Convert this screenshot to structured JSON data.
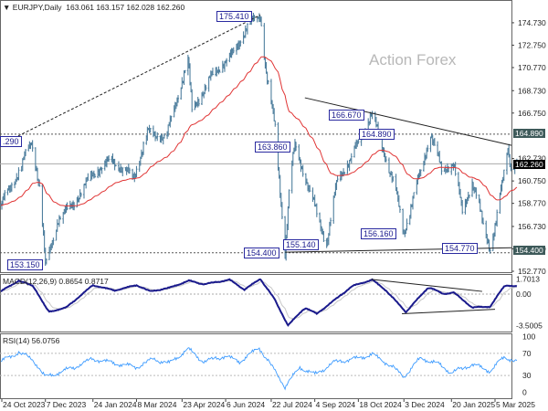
{
  "header": {
    "symbol_title": "EURJPY,Daily",
    "ohlc": "163.061 163.157 162.028 162.260"
  },
  "watermark": "Action Forex",
  "colors": {
    "bars": "#4f7f9e",
    "moving_average": "#e03434",
    "macd": "#1a1a8c",
    "macd_signal": "#c8c8c8",
    "rsi": "#3d9bff",
    "trendline": "#222222"
  },
  "chart_data": [
    {
      "type": "ohlc",
      "title": "EURJPY,Daily",
      "ylim": [
        152.77,
        175.9
      ],
      "yticks": [
        "174.730",
        "172.750",
        "170.770",
        "168.730",
        "166.750",
        "162.730",
        "160.750",
        "158.770",
        "156.730",
        "154.750",
        "152.770"
      ],
      "xticks": [
        {
          "label": "24 Oct 2023",
          "date": "2023-10-24"
        },
        {
          "label": "7 Dec 2023",
          "date": "2023-12-07"
        },
        {
          "label": "24 Jan 2024",
          "date": "2024-01-24"
        },
        {
          "label": "8 Mar 2024",
          "date": "2024-03-08"
        },
        {
          "label": "23 Apr 2024",
          "date": "2024-04-23"
        },
        {
          "label": "6 Jun 2024",
          "date": "2024-06-06"
        },
        {
          "label": "22 Jul 2024",
          "date": "2024-07-22"
        },
        {
          "label": "4 Sep 2024",
          "date": "2024-09-04"
        },
        {
          "label": "18 Oct 2024",
          "date": "2024-10-18"
        },
        {
          "label": "3 Dec 2024",
          "date": "2024-12-03"
        },
        {
          "label": "20 Jan 2025",
          "date": "2025-01-20"
        },
        {
          "label": "5 Mar 2025",
          "date": "2025-03-05"
        }
      ],
      "closes": [
        [
          "2023-10-23",
          158.6
        ],
        [
          "2023-11-09",
          161.4
        ],
        [
          "2023-11-23",
          164.2
        ],
        [
          "2023-12-02",
          159.8
        ],
        [
          "2023-12-07",
          153.15
        ],
        [
          "2023-12-20",
          157.4
        ],
        [
          "2024-01-03",
          158.6
        ],
        [
          "2024-01-24",
          161.4
        ],
        [
          "2024-02-12",
          162.6
        ],
        [
          "2024-03-05",
          161.0
        ],
        [
          "2024-03-19",
          165.0
        ],
        [
          "2024-04-07",
          164.6
        ],
        [
          "2024-04-29",
          171.5
        ],
        [
          "2024-05-03",
          167.0
        ],
        [
          "2024-05-25",
          170.3
        ],
        [
          "2024-06-13",
          171.9
        ],
        [
          "2024-06-27",
          174.3
        ],
        [
          "2024-07-11",
          175.41
        ],
        [
          "2024-07-17",
          170.3
        ],
        [
          "2024-07-26",
          165.4
        ],
        [
          "2024-08-05",
          154.4
        ],
        [
          "2024-08-10",
          161.0
        ],
        [
          "2024-08-15",
          163.86
        ],
        [
          "2024-09-02",
          159.0
        ],
        [
          "2024-09-16",
          155.14
        ],
        [
          "2024-09-27",
          161.0
        ],
        [
          "2024-10-10",
          162.6
        ],
        [
          "2024-10-31",
          166.67
        ],
        [
          "2024-11-07",
          165.0
        ],
        [
          "2024-11-25",
          159.8
        ],
        [
          "2024-12-03",
          156.16
        ],
        [
          "2024-12-30",
          164.89
        ],
        [
          "2025-01-10",
          161.8
        ],
        [
          "2025-01-22",
          162.2
        ],
        [
          "2025-01-31",
          158.2
        ],
        [
          "2025-02-10",
          160.6
        ],
        [
          "2025-02-28",
          154.77
        ],
        [
          "2025-03-06",
          157.0
        ],
        [
          "2025-03-18",
          163.9
        ],
        [
          "2025-03-21",
          161.8
        ],
        [
          "2025-03-27",
          162.26
        ]
      ],
      "price_labels": [
        "175.410",
        "166.670",
        "164.890",
        "163.860",
        ".290",
        "155.140",
        "154.400",
        "156.160",
        "154.770",
        "153.150"
      ],
      "horizontal_levels": [
        164.89,
        154.4
      ],
      "current_price": "162.260",
      "level_labels": {
        "upper": "164.890",
        "lower": "154.400"
      },
      "trendlines": [
        {
          "style": "dashed",
          "from": [
            "2023-10-24",
            164.0
          ],
          "to": [
            "2024-07-11",
            175.41
          ]
        },
        {
          "style": "solid",
          "from": [
            "2024-08-25",
            168.1
          ],
          "to": [
            "2025-03-31",
            163.9
          ]
        },
        {
          "style": "solid",
          "from": [
            "2024-08-05",
            154.45
          ],
          "to": [
            "2025-03-31",
            154.85
          ]
        }
      ]
    },
    {
      "type": "line",
      "title": "MACD(12,26,9) 0.8654 0.8717",
      "ylim": [
        -3.5005,
        1.7013
      ],
      "yticks": [
        "1.7013",
        "0.00",
        "-3.5005"
      ],
      "series": [
        {
          "name": "MACD(12,26,9)",
          "values": [
            [
              "2023-10-23",
              0.3
            ],
            [
              "2023-11-10",
              1.5
            ],
            [
              "2023-11-25",
              0.9
            ],
            [
              "2023-12-10",
              -2.0
            ],
            [
              "2023-12-28",
              -1.5
            ],
            [
              "2024-01-24",
              1.0
            ],
            [
              "2024-02-15",
              0.4
            ],
            [
              "2024-03-08",
              1.0
            ],
            [
              "2024-03-22",
              0.3
            ],
            [
              "2024-04-10",
              0.7
            ],
            [
              "2024-04-30",
              1.5
            ],
            [
              "2024-05-15",
              1.1
            ],
            [
              "2024-06-10",
              1.6
            ],
            [
              "2024-06-25",
              0.5
            ],
            [
              "2024-07-11",
              1.7
            ],
            [
              "2024-07-25",
              -0.5
            ],
            [
              "2024-08-08",
              -3.5
            ],
            [
              "2024-08-25",
              -1.5
            ],
            [
              "2024-09-06",
              -2.2
            ],
            [
              "2024-09-27",
              -0.4
            ],
            [
              "2024-10-12",
              0.9
            ],
            [
              "2024-11-01",
              1.6
            ],
            [
              "2024-11-15",
              0.4
            ],
            [
              "2024-12-05",
              -2.0
            ],
            [
              "2024-12-28",
              0.8
            ],
            [
              "2025-01-12",
              0.0
            ],
            [
              "2025-01-22",
              0.2
            ],
            [
              "2025-02-10",
              -1.5
            ],
            [
              "2025-02-28",
              -1.4
            ],
            [
              "2025-03-15",
              1.0
            ],
            [
              "2025-03-27",
              0.87
            ]
          ]
        }
      ]
    },
    {
      "type": "line",
      "title": "RSI(14) 56.0756",
      "ylim": [
        0,
        100
      ],
      "yticks": [
        "100",
        "70",
        "30",
        "0"
      ],
      "levels": [
        70,
        30
      ],
      "series": [
        {
          "name": "RSI(14)",
          "values": [
            [
              "2023-10-23",
              55
            ],
            [
              "2023-11-10",
              72
            ],
            [
              "2023-11-25",
              58
            ],
            [
              "2023-12-07",
              27
            ],
            [
              "2024-01-05",
              45
            ],
            [
              "2024-01-24",
              60
            ],
            [
              "2024-02-15",
              52
            ],
            [
              "2024-03-08",
              45
            ],
            [
              "2024-03-25",
              60
            ],
            [
              "2024-04-10",
              52
            ],
            [
              "2024-04-29",
              78
            ],
            [
              "2024-05-15",
              55
            ],
            [
              "2024-06-05",
              65
            ],
            [
              "2024-06-20",
              55
            ],
            [
              "2024-07-10",
              80
            ],
            [
              "2024-07-25",
              40
            ],
            [
              "2024-08-05",
              10
            ],
            [
              "2024-08-20",
              45
            ],
            [
              "2024-09-04",
              32
            ],
            [
              "2024-09-25",
              55
            ],
            [
              "2024-10-15",
              60
            ],
            [
              "2024-11-01",
              68
            ],
            [
              "2024-11-18",
              50
            ],
            [
              "2024-12-03",
              28
            ],
            [
              "2024-12-20",
              62
            ],
            [
              "2025-01-08",
              50
            ],
            [
              "2025-01-20",
              35
            ],
            [
              "2025-02-10",
              50
            ],
            [
              "2025-02-28",
              38
            ],
            [
              "2025-03-14",
              63
            ],
            [
              "2025-03-27",
              56
            ]
          ]
        }
      ]
    }
  ]
}
